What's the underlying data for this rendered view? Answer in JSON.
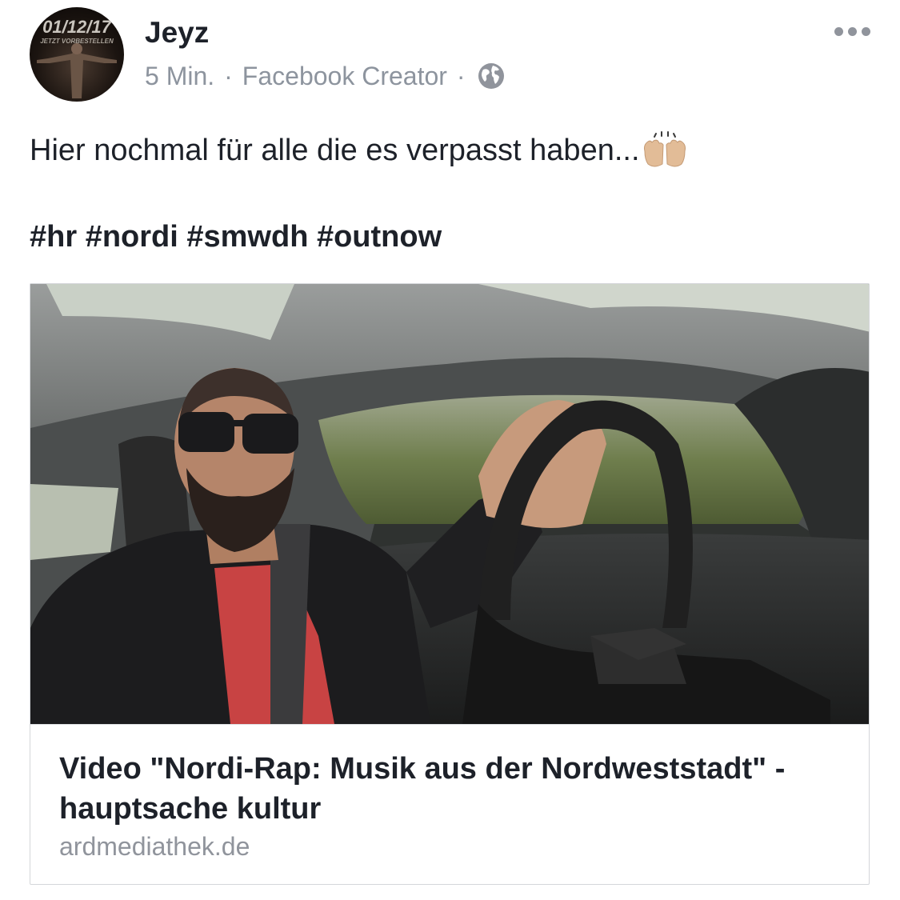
{
  "post": {
    "avatar": {
      "date_text": "01/12/17",
      "sub_text": "JETZT VORBESTELLEN"
    },
    "author": "Jeyz",
    "time": "5 Min.",
    "separator": "·",
    "app": "Facebook Creator",
    "privacy_icon": "globe-icon",
    "more_icon": "more-options-icon",
    "text": "Hier nochmal für alle die es verpasst haben...",
    "emoji": "raising-hands-emoji",
    "hashtags": "#hr #nordi #smwdh #outnow"
  },
  "link_preview": {
    "image": "man-driving-car-video-still",
    "title": "Video \"Nordi-Rap: Musik aus der Nordweststadt\" - hauptsache kultur",
    "domain": "ardmediathek.de"
  }
}
